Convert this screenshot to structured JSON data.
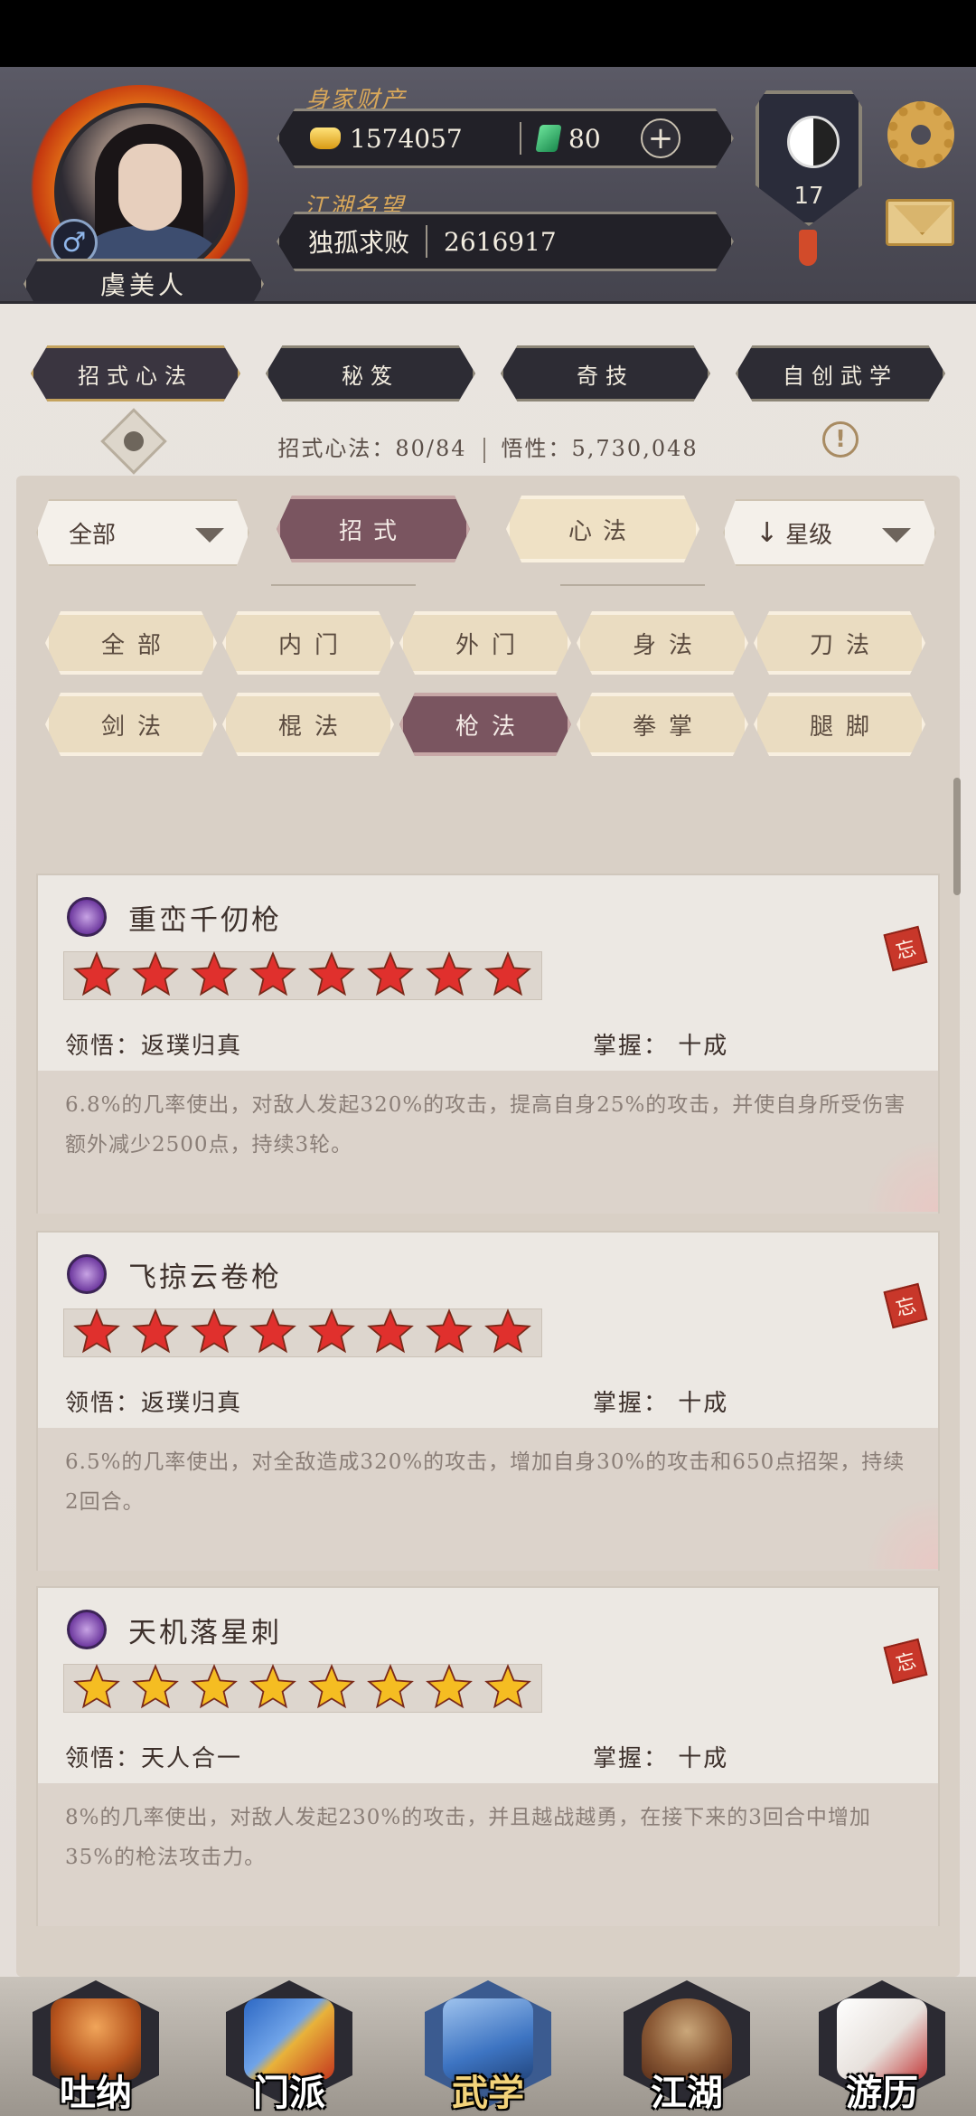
{
  "header": {
    "player_name": "虞美人",
    "gender_symbol": "♂",
    "assets_label": "身家财产",
    "gold_amount": "1574057",
    "jade_amount": "80",
    "add_symbol": "+",
    "reputation_label": "江湖名望",
    "reputation_title": "独孤求败",
    "reputation_value": "2616917",
    "level": "17"
  },
  "top_tabs": [
    {
      "label": "招式心法",
      "active": true
    },
    {
      "label": "秘笈",
      "active": false
    },
    {
      "label": "奇技",
      "active": false
    },
    {
      "label": "自创武学",
      "active": false
    }
  ],
  "stats": {
    "count_text": "招式心法：80/84",
    "insight_text": "悟性：5,730,048",
    "warning_symbol": "!"
  },
  "filters": {
    "category_dropdown": "全部",
    "segment_tabs": [
      {
        "label": "招式",
        "active": true
      },
      {
        "label": "心法",
        "active": false
      }
    ],
    "sort_arrow": "↓",
    "sort_dropdown": "星级",
    "chips_row1": [
      {
        "label": "全部",
        "active": false
      },
      {
        "label": "内门",
        "active": false
      },
      {
        "label": "外门",
        "active": false
      },
      {
        "label": "身法",
        "active": false
      },
      {
        "label": "刀法",
        "active": false
      }
    ],
    "chips_row2": [
      {
        "label": "剑法",
        "active": false
      },
      {
        "label": "棍法",
        "active": false
      },
      {
        "label": "枪法",
        "active": true
      },
      {
        "label": "拳掌",
        "active": false
      },
      {
        "label": "腿脚",
        "active": false
      }
    ]
  },
  "skills": [
    {
      "name": "重峦千仞枪",
      "stars": 8,
      "star_color": "#e0302d",
      "insight": "领悟：返璞归真",
      "mastery": "掌握：  十成",
      "forget_label": "忘",
      "description": "6.8%的几率使出，对敌人发起320%的攻击，提高自身25%的攻击，并使自身所受伤害额外减少2500点，持续3轮。"
    },
    {
      "name": "飞掠云卷枪",
      "stars": 8,
      "star_color": "#e0302d",
      "insight": "领悟：返璞归真",
      "mastery": "掌握：  十成",
      "forget_label": "忘",
      "description": "6.5%的几率使出，对全敌造成320%的攻击，增加自身30%的攻击和650点招架，持续2回合。"
    },
    {
      "name": "天机落星刺",
      "stars": 8,
      "star_color": "#f5bd22",
      "insight": "领悟：天人合一",
      "mastery": "掌握：  十成",
      "forget_label": "忘",
      "description": "8%的几率使出，对敌人发起230%的攻击，并且越战越勇，在接下来的3回合中增加35%的枪法攻击力。"
    }
  ],
  "bottom_nav": [
    {
      "label": "吐纳",
      "active": false
    },
    {
      "label": "门派",
      "active": false
    },
    {
      "label": "武学",
      "active": true
    },
    {
      "label": "江湖",
      "active": false
    },
    {
      "label": "游历",
      "active": false
    }
  ]
}
